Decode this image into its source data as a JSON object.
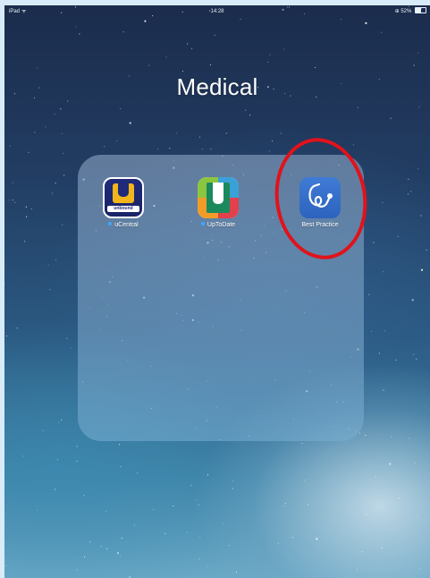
{
  "status_bar": {
    "device": "iPad",
    "time": "14:28",
    "battery": "52%",
    "battery_level": 0.52
  },
  "folder": {
    "title": "Medical",
    "apps": [
      {
        "label": "uCentral",
        "icon": "ucentral-icon",
        "badge_text": "unbound",
        "has_new_dot": true
      },
      {
        "label": "UpToDate",
        "icon": "uptodate-icon",
        "has_new_dot": true
      },
      {
        "label": "Best Practice",
        "icon": "best-practice-icon",
        "has_new_dot": false
      }
    ]
  },
  "colors": {
    "annotation": "#e0131b",
    "new_dot": "#3fa6ff"
  }
}
